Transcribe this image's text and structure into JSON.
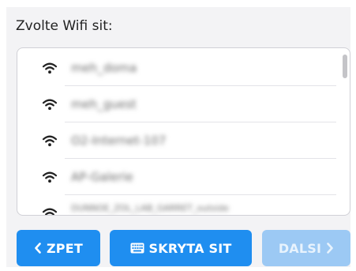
{
  "title": "Zvolte Wifi sit:",
  "networks": [
    {
      "ssid": "meh_doma"
    },
    {
      "ssid": "meh_guest"
    },
    {
      "ssid": "O2-Internet-107"
    },
    {
      "ssid": "AP-Galerie"
    },
    {
      "ssid": "DUNNOE_ZOL_LAB_GARRET_outside"
    }
  ],
  "buttons": {
    "back": {
      "label": "ZPET",
      "icon": "chevron-left-icon"
    },
    "hidden": {
      "label": "SKRYTA SIT",
      "icon": "keyboard-icon"
    },
    "next": {
      "label": "DALSI",
      "icon": "chevron-right-icon",
      "enabled": false
    }
  },
  "colors": {
    "accent": "#1f8ef0",
    "accent_disabled": "#9cc9f4",
    "panel_bg": "#f3f3f5"
  }
}
